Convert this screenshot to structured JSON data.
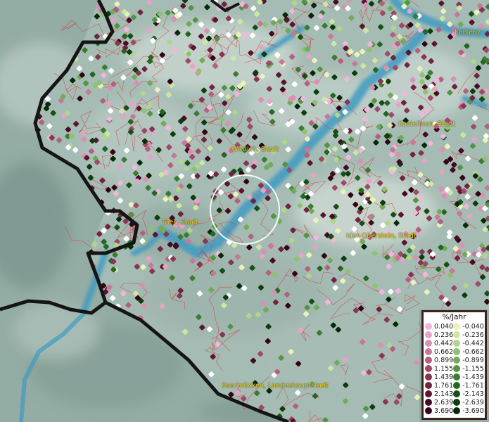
{
  "map": {
    "places": [
      {
        "key": "koblenz",
        "name": "Koblenz"
      },
      {
        "key": "kastellaun",
        "name": "Kastellaun, Stadt"
      },
      {
        "key": "wittlich",
        "name": "Wittlich, Stadt"
      },
      {
        "key": "trier",
        "name": "Trier, Stadt"
      },
      {
        "key": "idar",
        "name": "Idar-Oberstein, Stadt"
      },
      {
        "key": "saarbruecken",
        "name": "Saarbrücken, Landeshauptstadt"
      }
    ],
    "legend": {
      "title": "%/Jahr",
      "positive": [
        {
          "label": "0.040",
          "color": "#f2b6dc"
        },
        {
          "label": "0.236",
          "color": "#e8a2c8"
        },
        {
          "label": "0.442",
          "color": "#dc8eb3"
        },
        {
          "label": "0.662",
          "color": "#c97798"
        },
        {
          "label": "0.899",
          "color": "#b5607e"
        },
        {
          "label": "1.155",
          "color": "#9e4a66"
        },
        {
          "label": "1.439",
          "color": "#873552"
        },
        {
          "label": "1.761",
          "color": "#712340"
        },
        {
          "label": "2.143",
          "color": "#5c1530"
        },
        {
          "label": "2.639",
          "color": "#470a22"
        },
        {
          "label": "3.690",
          "color": "#320416"
        }
      ],
      "negative": [
        {
          "label": "-0.040",
          "color": "#eaf2b8"
        },
        {
          "label": "-0.236",
          "color": "#cde6a2"
        },
        {
          "label": "-0.442",
          "color": "#afd68a"
        },
        {
          "label": "-0.662",
          "color": "#8fc270"
        },
        {
          "label": "-0.899",
          "color": "#6fab58"
        },
        {
          "label": "-1.155",
          "color": "#529442"
        },
        {
          "label": "-1.439",
          "color": "#3a7c30"
        },
        {
          "label": "-1.761",
          "color": "#266622"
        },
        {
          "label": "-2.143",
          "color": "#165016"
        },
        {
          "label": "-2.639",
          "color": "#0c3d0e"
        },
        {
          "label": "-3.690",
          "color": "#052a07"
        }
      ]
    }
  }
}
